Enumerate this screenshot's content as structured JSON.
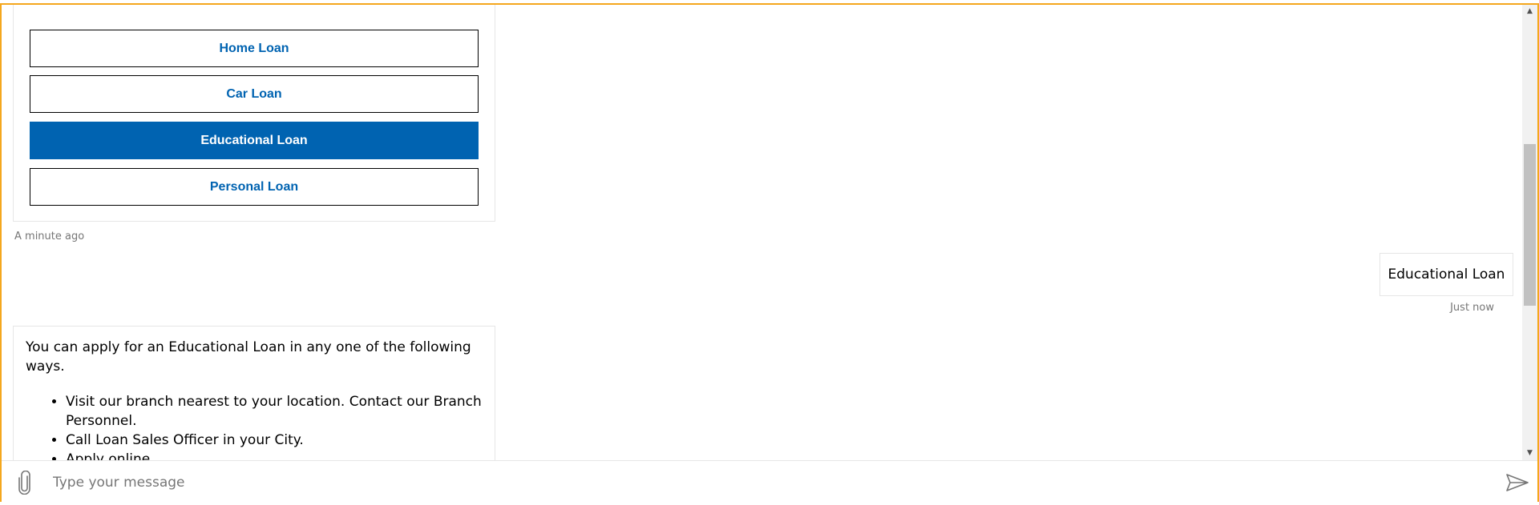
{
  "options": [
    {
      "label": "Home Loan",
      "selected": false
    },
    {
      "label": "Car Loan",
      "selected": false
    },
    {
      "label": "Educational Loan",
      "selected": true
    },
    {
      "label": "Personal Loan",
      "selected": false
    }
  ],
  "bot_card_timestamp": "A minute ago",
  "user_message": {
    "text": "Educational Loan",
    "timestamp": "Just now"
  },
  "bot_reply": {
    "intro": "You can apply for an Educational Loan in any one of the following ways.",
    "items": [
      "Visit our branch nearest to your location. Contact our Branch Personnel.",
      "Call Loan Sales Officer in your City.",
      "Apply online"
    ]
  },
  "input": {
    "placeholder": "Type your message",
    "value": ""
  },
  "icons": {
    "attach": "paperclip-icon",
    "send": "send-icon",
    "scroll_up": "chevron-up-icon",
    "scroll_down": "chevron-down-icon"
  },
  "colors": {
    "accent": "#0063b1",
    "frame_border": "#f4a71d",
    "muted_text": "#767676"
  }
}
